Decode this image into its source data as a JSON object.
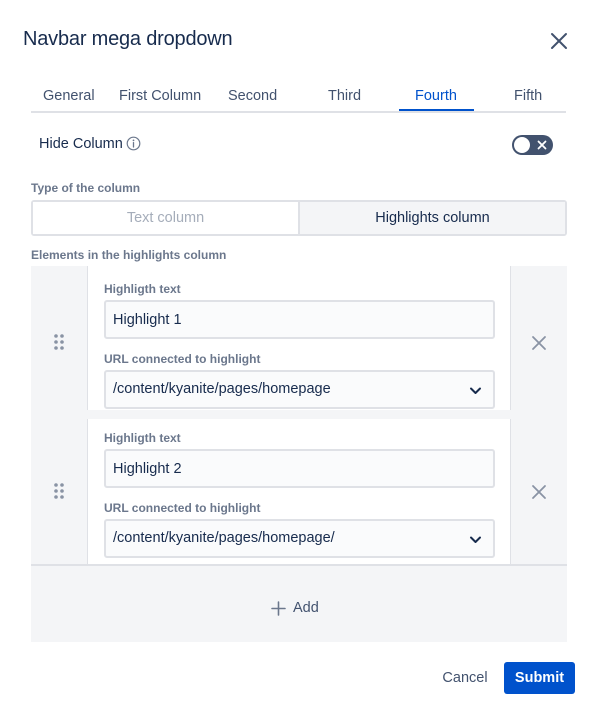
{
  "dialog": {
    "title": "Navbar mega dropdown",
    "close_icon": "close-icon"
  },
  "tabs": [
    {
      "label": "General",
      "active": false
    },
    {
      "label": "First Column",
      "active": false
    },
    {
      "label": "Second",
      "active": false
    },
    {
      "label": "Third",
      "active": false
    },
    {
      "label": "Fourth",
      "active": true
    },
    {
      "label": "Fifth",
      "active": false
    }
  ],
  "hide_column": {
    "label": "Hide Column",
    "info_icon": "info-icon",
    "toggle_on": false,
    "toggle_icon": "cross-icon"
  },
  "column_type": {
    "label": "Type of the column",
    "options": [
      "Text column",
      "Highlights column"
    ],
    "selected": "Highlights column"
  },
  "highlights": {
    "label": "Elements in the highlights column",
    "items": [
      {
        "text_label": "Highligth text",
        "text_value": "Highlight 1",
        "url_label": "URL connected to highlight",
        "url_value": "/content/kyanite/pages/homepage"
      },
      {
        "text_label": "Highligth text",
        "text_value": "Highlight 2",
        "url_label": "URL connected to highlight",
        "url_value": "/content/kyanite/pages/homepage/"
      }
    ],
    "add_label": "Add"
  },
  "footer": {
    "cancel_label": "Cancel",
    "submit_label": "Submit"
  },
  "colors": {
    "primary": "#0052cc",
    "text": "#172b4d",
    "subtle_text": "#6b778c",
    "border": "#dfe1e6",
    "panel_bg": "#f4f5f7",
    "toggle_off": "#42526e"
  }
}
